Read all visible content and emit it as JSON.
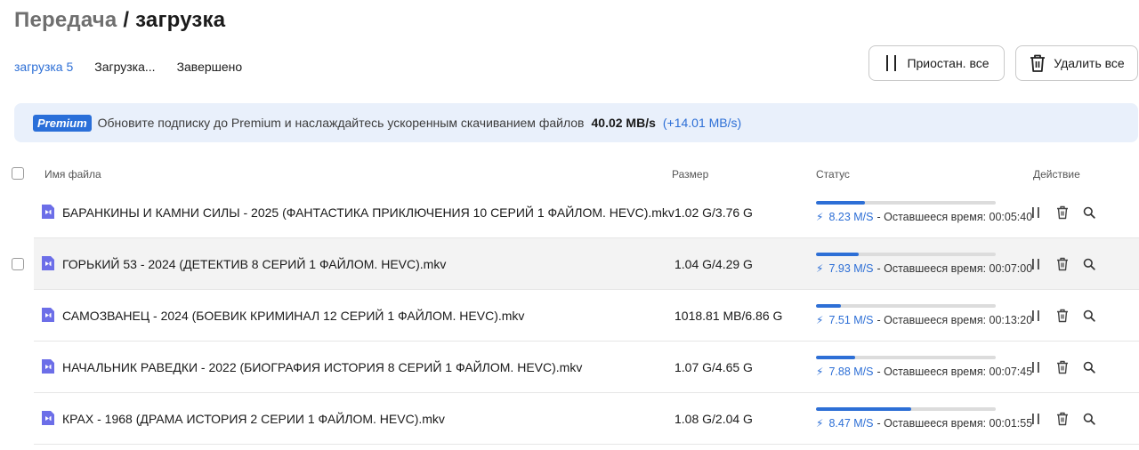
{
  "page": {
    "title_parent": "Передача",
    "title_separator": " / ",
    "title_current": "загрузка"
  },
  "tabs": [
    {
      "label": "загрузка 5",
      "active": true
    },
    {
      "label": "Загрузка...",
      "active": false
    },
    {
      "label": "Завершено",
      "active": false
    }
  ],
  "toolbar": {
    "pause_all_label": "Приостан. все",
    "delete_all_label": "Удалить все"
  },
  "banner": {
    "badge": "Premium",
    "text": "Обновите подписку до Premium и наслаждайтесь ускоренным скачиванием файлов",
    "speed": "40.02 MB/s",
    "bonus": "(+14.01 MB/s)"
  },
  "table": {
    "columns": {
      "name": "Имя файла",
      "size": "Размер",
      "status": "Статус",
      "action": "Действие"
    },
    "rows": [
      {
        "name": "БАРАНКИНЫ И КАМНИ СИЛЫ - 2025 (ФАНТАСТИКА ПРИКЛЮЧЕНИЯ 10 СЕРИЙ 1 ФАЙЛОМ. HEVC).mkv",
        "size": "1.02 G/3.76 G",
        "progress": 0.27,
        "speed": "8.23 M/S",
        "remaining": "- Оставшееся время: 00:05:40"
      },
      {
        "name": "ГОРЬКИЙ 53 - 2024 (ДЕТЕКТИВ 8 СЕРИЙ 1 ФАЙЛОМ. HEVC).mkv",
        "size": "1.04 G/4.29 G",
        "progress": 0.24,
        "speed": "7.93 M/S",
        "remaining": "- Оставшееся время: 00:07:00"
      },
      {
        "name": "САМОЗВАНЕЦ - 2024 (БОЕВИК КРИМИНАЛ 12 СЕРИЙ 1 ФАЙЛОМ. HEVC).mkv",
        "size": "1018.81 MB/6.86 G",
        "progress": 0.14,
        "speed": "7.51 M/S",
        "remaining": "- Оставшееся время: 00:13:20"
      },
      {
        "name": "НАЧАЛЬНИК РАВЕДКИ - 2022 (БИОГРАФИЯ ИСТОРИЯ 8 СЕРИЙ 1 ФАЙЛОМ. HEVC).mkv",
        "size": "1.07 G/4.65 G",
        "progress": 0.22,
        "speed": "7.88 M/S",
        "remaining": "- Оставшееся время: 00:07:45"
      },
      {
        "name": "КРАХ - 1968 (ДРАМА ИСТОРИЯ 2 СЕРИИ 1 ФАЙЛОМ. HEVC).mkv",
        "size": "1.08 G/2.04 G",
        "progress": 0.53,
        "speed": "8.47 M/S",
        "remaining": "- Оставшееся время: 00:01:55"
      }
    ]
  },
  "colors": {
    "accent": "#2d6fd6",
    "file_icon": "#6c6ee8",
    "banner_bg": "#e9f0fb"
  },
  "icons": {
    "file": "video-file-icon",
    "pause": "pause-icon",
    "delete": "trash-icon",
    "search": "search-icon",
    "speed": "lightning-icon"
  }
}
